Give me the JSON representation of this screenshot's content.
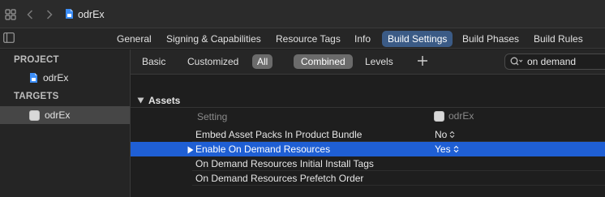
{
  "titlebar": {
    "file_name": "odrEx"
  },
  "tabs": [
    {
      "label": "General",
      "active": false
    },
    {
      "label": "Signing & Capabilities",
      "active": false
    },
    {
      "label": "Resource Tags",
      "active": false
    },
    {
      "label": "Info",
      "active": false
    },
    {
      "label": "Build Settings",
      "active": true
    },
    {
      "label": "Build Phases",
      "active": false
    },
    {
      "label": "Build Rules",
      "active": false
    }
  ],
  "sidebar": {
    "project_header": "PROJECT",
    "project_item": "odrEx",
    "targets_header": "TARGETS",
    "target_item": "odrEx"
  },
  "filters": {
    "basic": "Basic",
    "customized": "Customized",
    "all": "All",
    "combined": "Combined",
    "levels": "Levels",
    "search_value": "on demand"
  },
  "settings": {
    "group_title": "Assets",
    "column_setting": "Setting",
    "column_target": "odrEx",
    "rows": [
      {
        "name": "Embed Asset Packs In Product Bundle",
        "value": "No",
        "selected": false
      },
      {
        "name": "Enable On Demand Resources",
        "value": "Yes",
        "selected": true
      },
      {
        "name": "On Demand Resources Initial Install Tags",
        "value": "",
        "selected": false
      },
      {
        "name": "On Demand Resources Prefetch Order",
        "value": "",
        "selected": false
      }
    ]
  },
  "colors": {
    "accent_tab": "#3b5b86",
    "selection": "#1f5fd4",
    "file_icon": "#3d8ef7"
  }
}
